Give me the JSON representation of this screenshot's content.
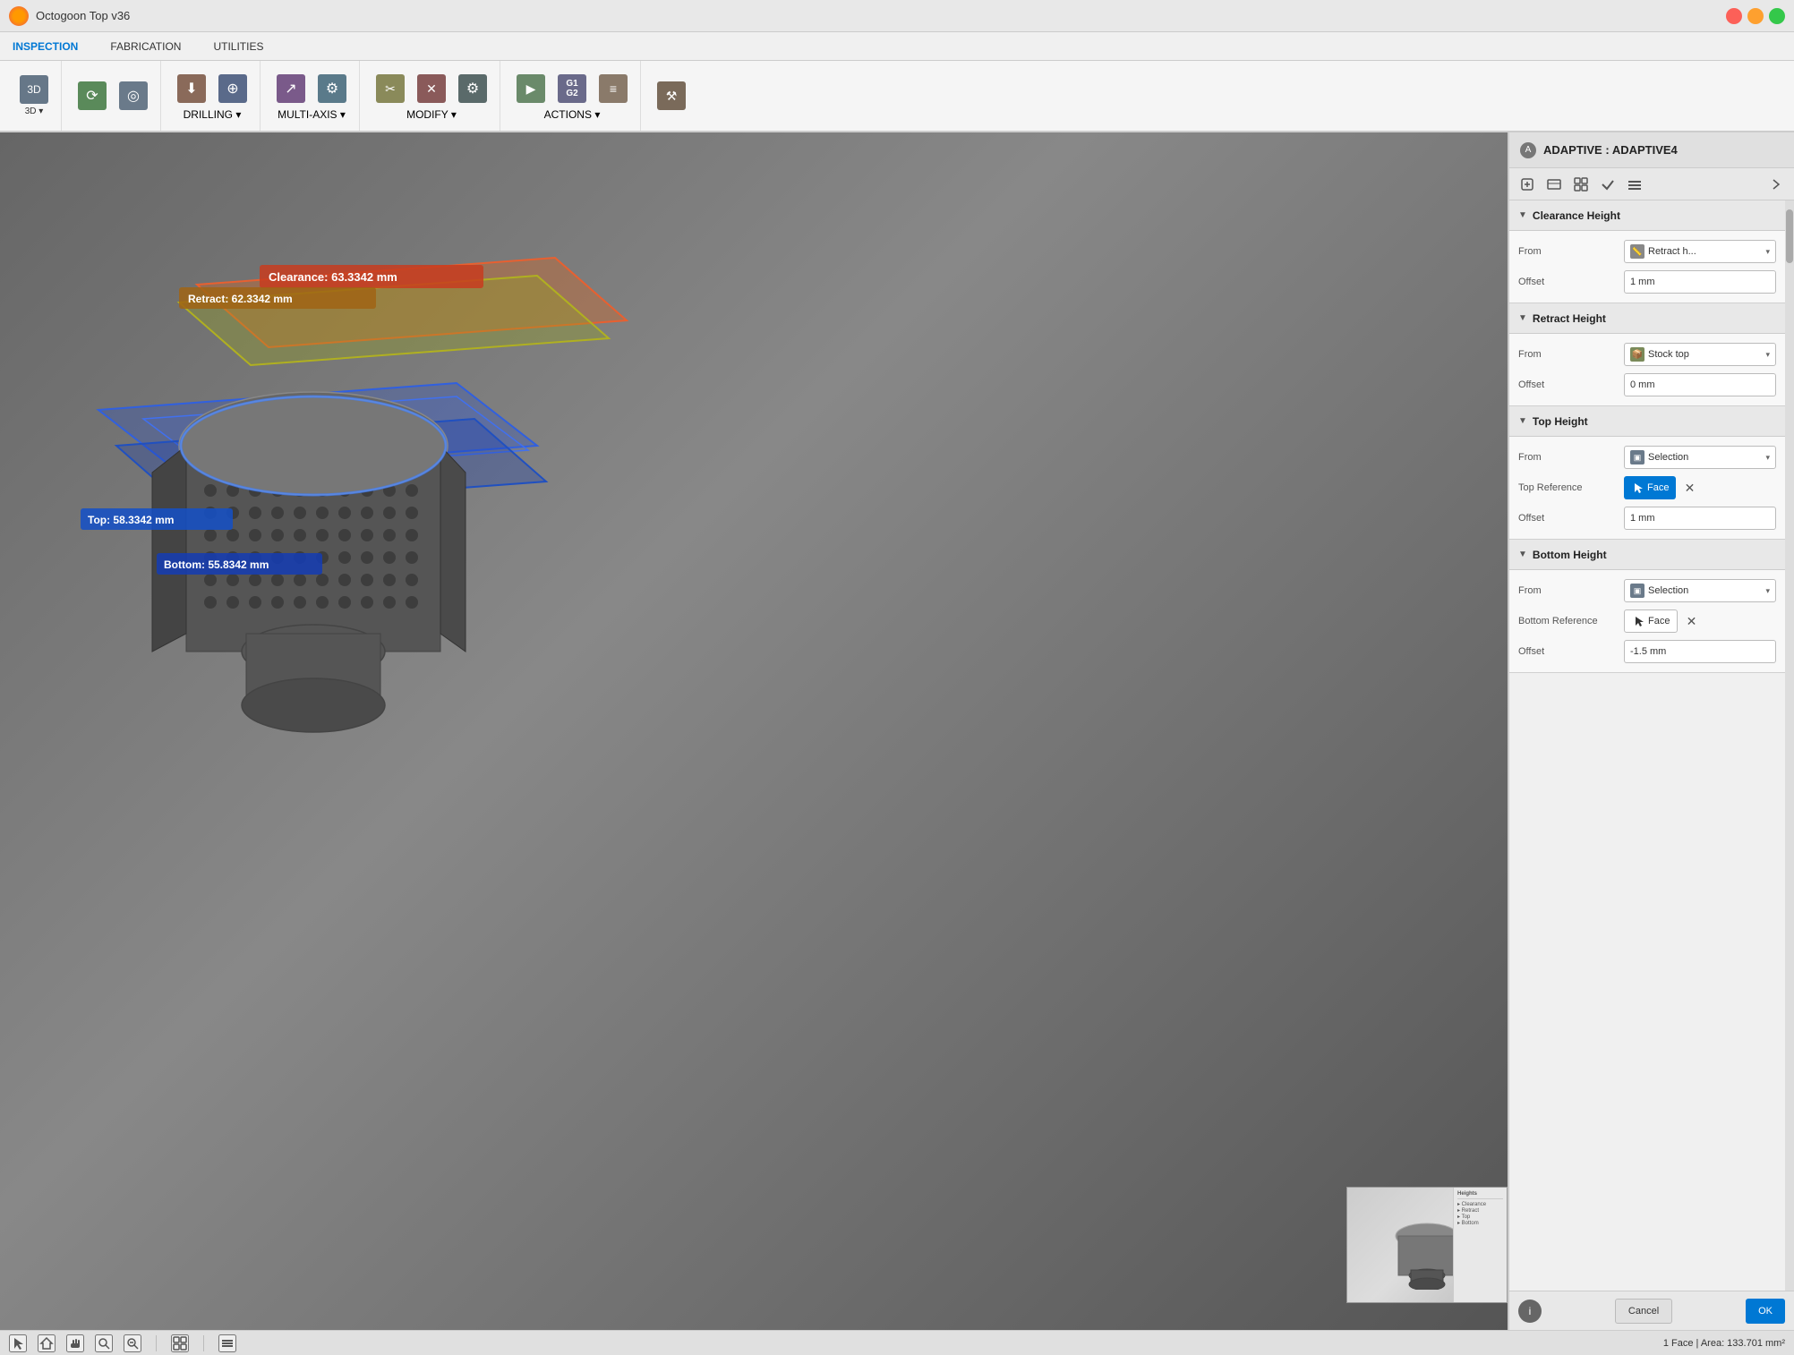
{
  "titleBar": {
    "appName": "Octogoon Top v36",
    "logoColor": "#f90"
  },
  "menuBar": {
    "items": [
      {
        "id": "inspection",
        "label": "INSPECTION"
      },
      {
        "id": "fabrication",
        "label": "FABRICATION"
      },
      {
        "id": "utilities",
        "label": "UTILITIES"
      }
    ]
  },
  "toolbar": {
    "groups": [
      {
        "id": "g2d3d",
        "buttons": [
          {
            "id": "2d3d",
            "label": "3D ▾",
            "icon": "📐"
          }
        ]
      },
      {
        "id": "gDrilling",
        "buttons": [
          {
            "id": "drill-icon1",
            "label": "",
            "icon": "⚙"
          },
          {
            "id": "drill-icon2",
            "label": "",
            "icon": "🔧"
          }
        ],
        "groupLabel": "DRILLING ▾"
      },
      {
        "id": "gMultiAxis",
        "buttons": [
          {
            "id": "ma-icon1",
            "label": "",
            "icon": "↗"
          },
          {
            "id": "ma-icon2",
            "label": "",
            "icon": "↙"
          }
        ],
        "groupLabel": "MULTI-AXIS ▾"
      },
      {
        "id": "gModify",
        "buttons": [
          {
            "id": "mod-icon1",
            "label": "",
            "icon": "✂"
          },
          {
            "id": "mod-icon2",
            "label": "",
            "icon": "✕"
          },
          {
            "id": "mod-icon3",
            "label": "",
            "icon": "⚙"
          }
        ],
        "groupLabel": "MODIFY ▾"
      },
      {
        "id": "gActions",
        "buttons": [
          {
            "id": "act-icon1",
            "label": "",
            "icon": "▶"
          },
          {
            "id": "act-icon2",
            "label": "G1/G2",
            "icon": "G"
          },
          {
            "id": "act-icon3",
            "label": "",
            "icon": "≡"
          }
        ],
        "groupLabel": "ACTIONS ▾"
      }
    ]
  },
  "viewport": {
    "bgColor": "#5a6a7a",
    "annotations": {
      "clearance": "Clearance: 63.3342 mm",
      "retract": "Retract: 62.3342 mm",
      "top": "Top: 58.3342 mm",
      "bottom": "Bottom: 55.8342 mm"
    }
  },
  "panel": {
    "header": {
      "prefix": "ADAPTIVE",
      "title": "ADAPTIVE4"
    },
    "sections": {
      "clearanceHeight": {
        "title": "Clearance Height",
        "from": {
          "label": "From",
          "value": "Retract h...",
          "icon": "📏"
        },
        "offset": {
          "label": "Offset",
          "value": "1 mm"
        }
      },
      "retractHeight": {
        "title": "Retract Height",
        "from": {
          "label": "From",
          "value": "Stock top",
          "icon": "📦"
        },
        "offset": {
          "label": "Offset",
          "value": "0 mm"
        }
      },
      "topHeight": {
        "title": "Top Height",
        "from": {
          "label": "From",
          "value": "Selection",
          "icon": "🔲"
        },
        "topReference": {
          "label": "Top Reference",
          "value": "Face"
        },
        "offset": {
          "label": "Offset",
          "value": "1 mm"
        }
      },
      "bottomHeight": {
        "title": "Bottom Height",
        "from": {
          "label": "From",
          "value": "Selection",
          "icon": "🔲"
        },
        "bottomReference": {
          "label": "Bottom Reference",
          "value": "Face"
        },
        "offset": {
          "label": "Offset",
          "value": "-1.5 mm"
        }
      }
    }
  },
  "statusBar": {
    "faceInfo": "1 Face | Area: 133.701 mm²"
  },
  "labels": {
    "from": "From",
    "offset": "Offset",
    "topReference": "Top Reference",
    "bottomReference": "Bottom Reference",
    "face": "Face",
    "ok": "OK",
    "cancel": "Cancel"
  }
}
